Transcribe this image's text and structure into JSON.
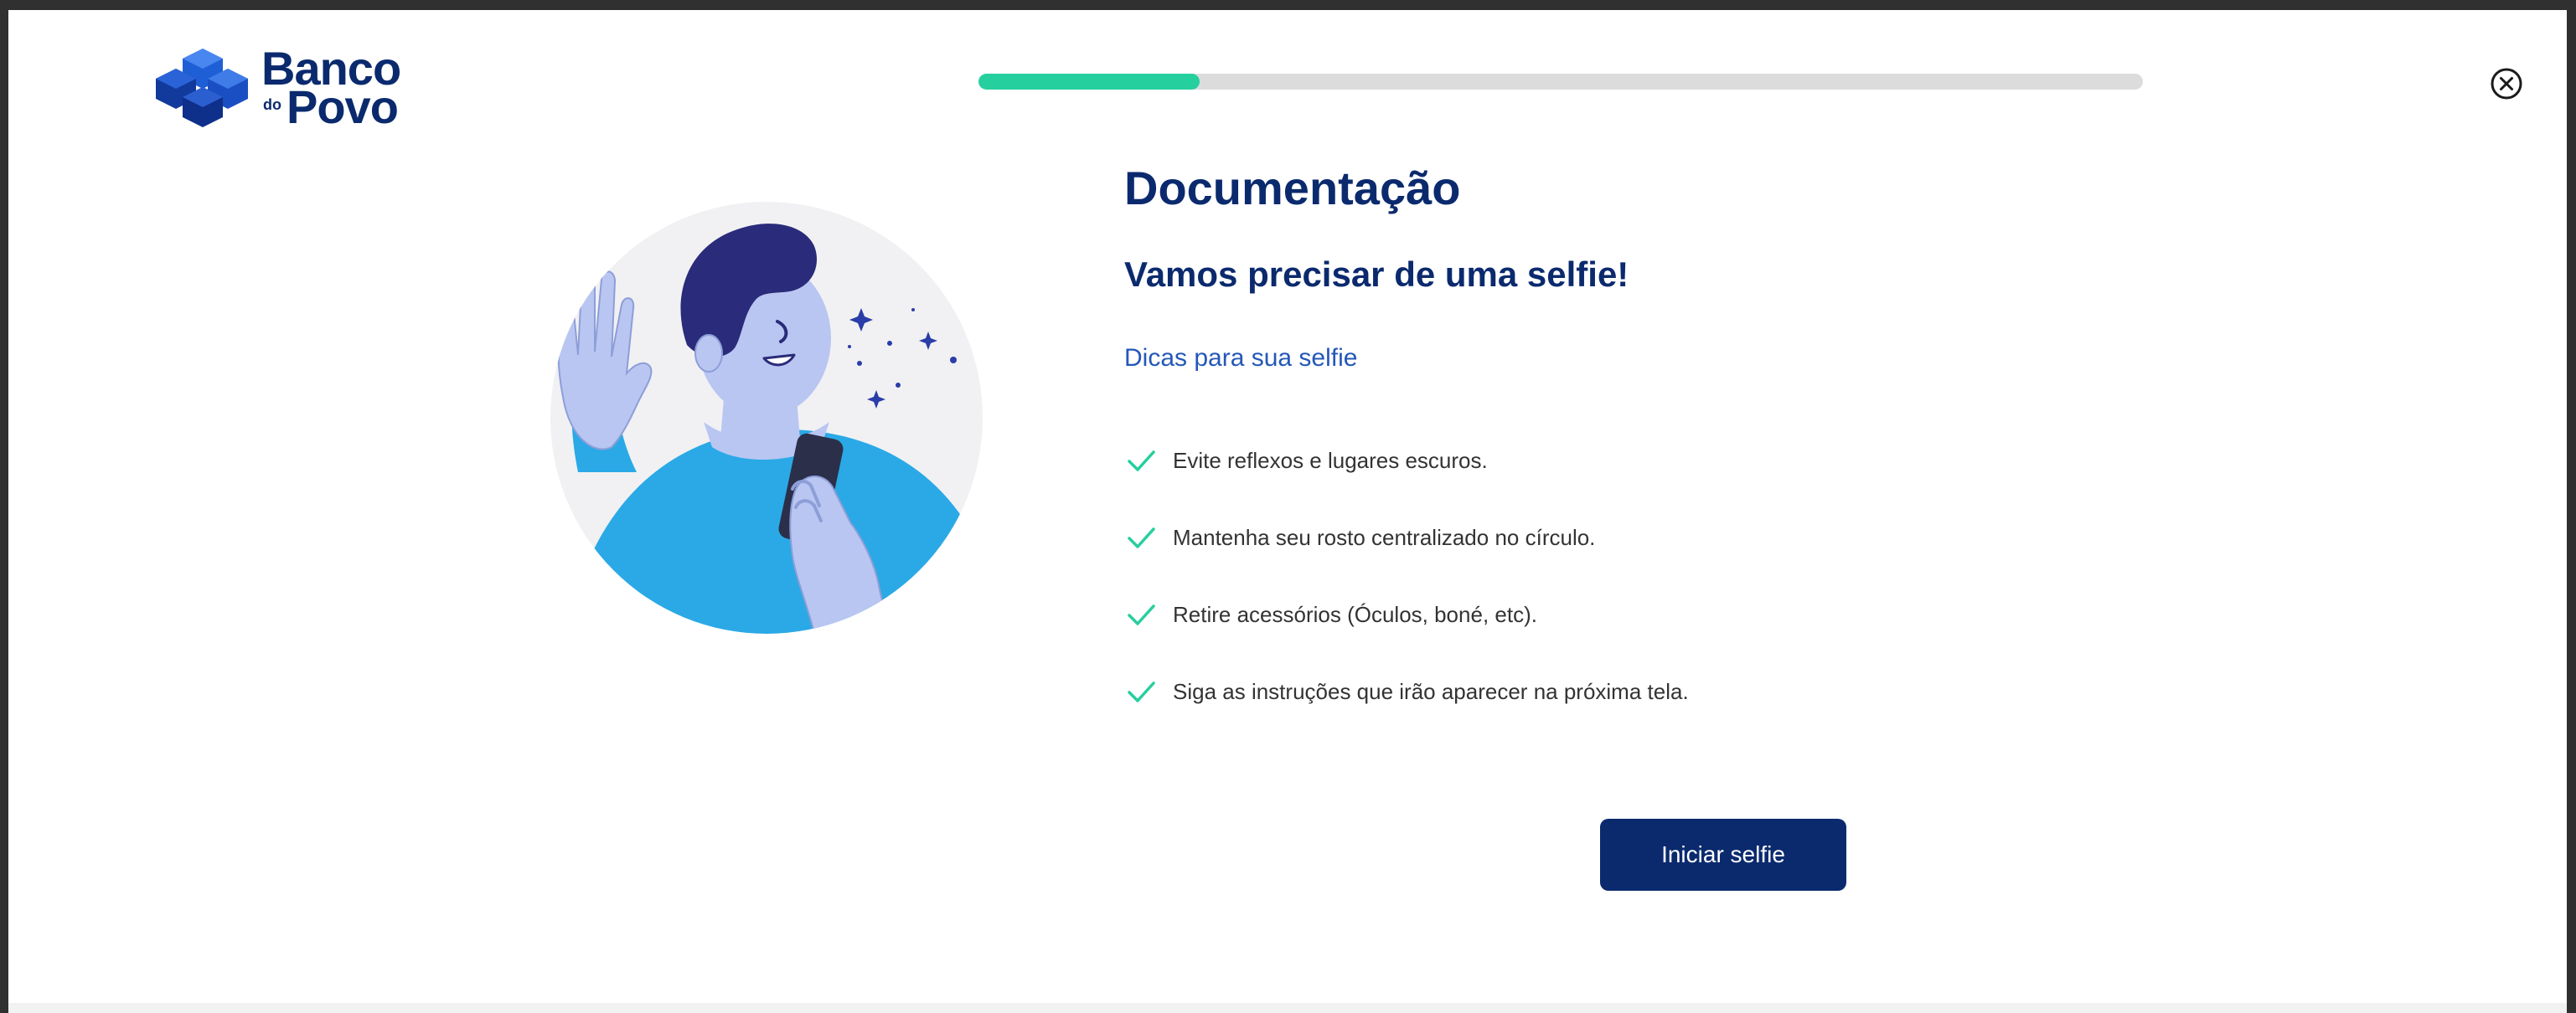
{
  "brand": {
    "line1": "Banco",
    "small": "do",
    "line2": "Povo",
    "logo_icon": "cube-cluster-logo",
    "color": "#0b2a6e"
  },
  "progress": {
    "value": 0.19,
    "fill_color": "#26cf9e",
    "track_color": "#dcdcdc"
  },
  "close_icon": "close-circle-icon",
  "illustration": {
    "icon": "person-selfie-illustration"
  },
  "content": {
    "title": "Documentação",
    "subtitle": "Vamos precisar de uma selfie!",
    "tips_heading": "Dicas para sua selfie",
    "tips": [
      {
        "text": "Evite reflexos e lugares escuros.",
        "icon": "check-icon"
      },
      {
        "text": "Mantenha seu rosto centralizado no círculo.",
        "icon": "check-icon"
      },
      {
        "text": "Retire acessórios (Óculos, boné, etc).",
        "icon": "check-icon"
      },
      {
        "text": "Siga as instruções que irão aparecer na próxima tela.",
        "icon": "check-icon"
      }
    ]
  },
  "actions": {
    "start_label": "Iniciar selfie"
  },
  "colors": {
    "primary": "#0b2a6e",
    "accent": "#26cf9e",
    "link": "#2457b8"
  }
}
